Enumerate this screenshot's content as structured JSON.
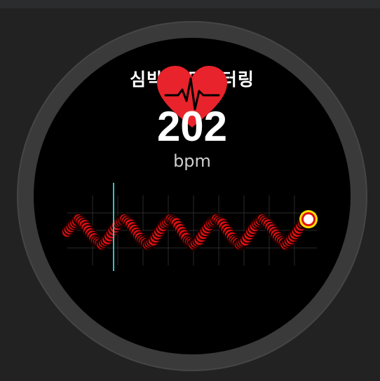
{
  "watch": {
    "title": "심박수 모니터링",
    "bpm_value": "202",
    "bpm_unit": "bpm"
  },
  "colors": {
    "heart": "#e8232b",
    "trace": "#e01010",
    "cursor": "#2ec4c4",
    "marker_ring": "#ffe000",
    "grid": "#2a2a2a"
  },
  "chart_data": {
    "type": "line",
    "title": "",
    "xlabel": "",
    "ylabel": "",
    "grid": true,
    "series": [
      {
        "values": [
          0,
          0.55,
          1,
          0.55,
          -0.1,
          -0.7,
          -1,
          -0.6,
          0.1,
          0.75,
          1,
          0.6,
          -0.05,
          -0.65,
          -1,
          -0.7,
          0,
          0.65,
          1,
          0.7,
          0,
          -0.7,
          -1,
          -0.65,
          0.05,
          0.7,
          1,
          0.65,
          0,
          -0.65,
          -1,
          -0.7,
          0,
          0.65,
          1,
          0.6,
          0,
          -0.6,
          -1,
          -0.6,
          0,
          0.7,
          1
        ]
      }
    ]
  }
}
